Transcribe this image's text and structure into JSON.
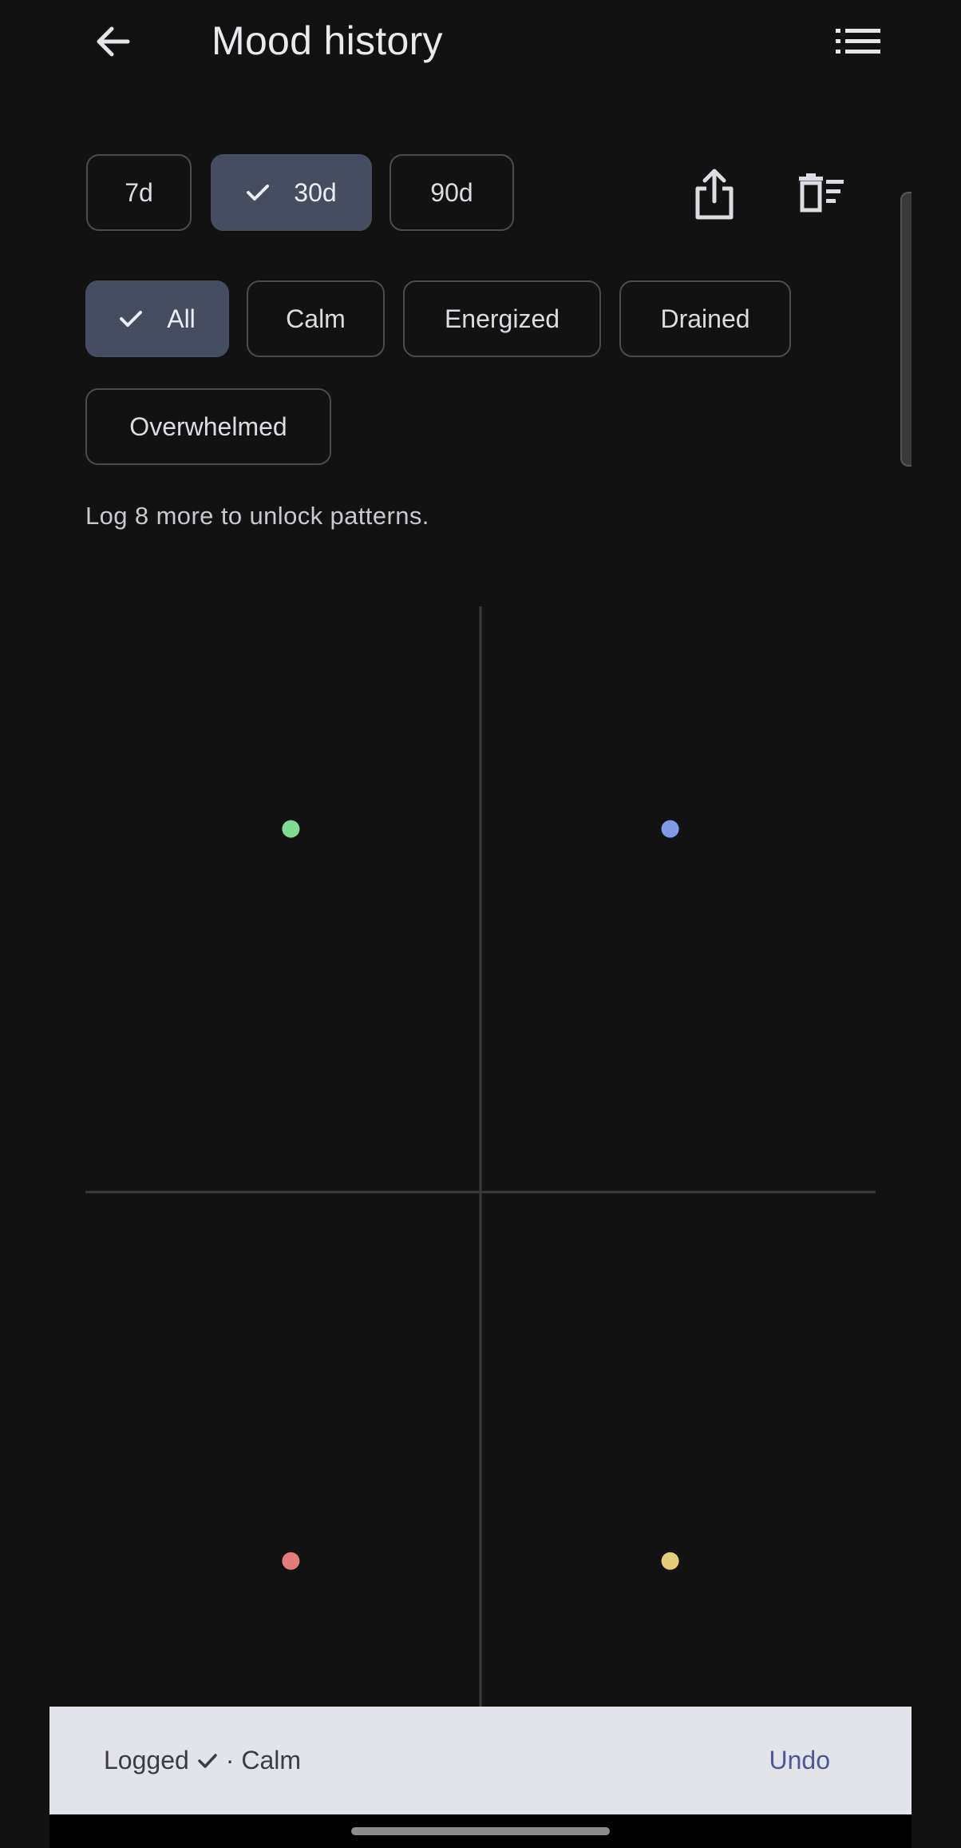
{
  "app_bar": {
    "title": "Mood history",
    "back_icon": "arrow-left-icon",
    "list_icon": "list-icon"
  },
  "range_filters": [
    {
      "label": "7d",
      "selected": false
    },
    {
      "label": "30d",
      "selected": true
    },
    {
      "label": "90d",
      "selected": false
    }
  ],
  "actions": {
    "share_icon": "share-icon",
    "clear_icon": "delete-sweep-icon"
  },
  "mood_filters": [
    {
      "label": "All",
      "selected": true
    },
    {
      "label": "Calm",
      "selected": false
    },
    {
      "label": "Energized",
      "selected": false
    },
    {
      "label": "Drained",
      "selected": false
    },
    {
      "label": "Overwhelmed",
      "selected": false
    }
  ],
  "hint": "Log 8 more to unlock patterns.",
  "colors": {
    "background": "#121212",
    "chip_selected": "#474d61",
    "axis": "#3a3a3c",
    "green": "#7ddc92",
    "blue": "#7f9be8",
    "red": "#e57c7c",
    "yellow": "#e6cc79",
    "snackbar": "#e3e3ea",
    "undo": "#4d5796"
  },
  "chart_data": {
    "type": "scatter",
    "xlim": [
      -1,
      1
    ],
    "ylim": [
      -1,
      1
    ],
    "points": [
      {
        "x": -0.48,
        "y": 0.62,
        "color": "#7ddc92"
      },
      {
        "x": 0.48,
        "y": 0.62,
        "color": "#7f9be8"
      },
      {
        "x": -0.48,
        "y": -0.63,
        "color": "#e57c7c"
      },
      {
        "x": 0.48,
        "y": -0.63,
        "color": "#e6cc79"
      }
    ]
  },
  "snackbar": {
    "prefix": "Logged",
    "suffix": "· Calm",
    "action": "Undo"
  }
}
